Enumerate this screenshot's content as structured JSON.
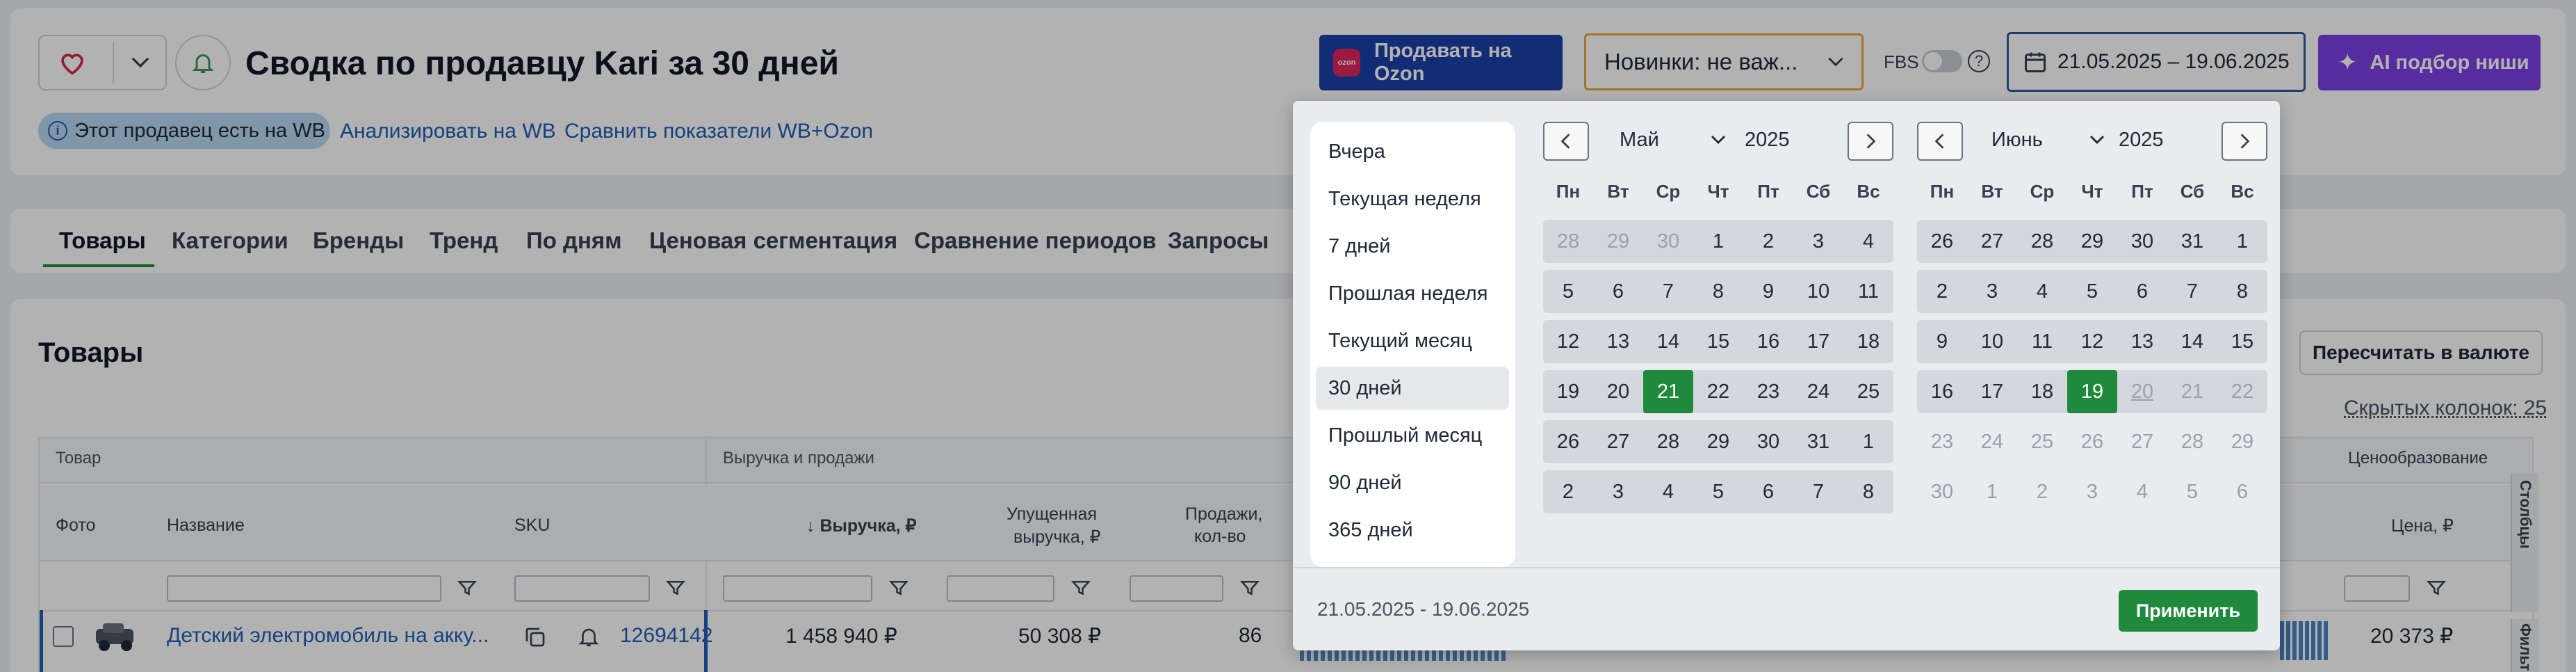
{
  "header": {
    "title": "Сводка по продавцу Kari за 30 дней",
    "ozon_button": "Продавать на Ozon",
    "ozon_badge": "ozon",
    "novelty_select": "Новинки: не важ...",
    "fbs_label": "FBS",
    "date_range": "21.05.2025 – 19.06.2025",
    "ai_button": "AI подбор ниши",
    "wb_badge": "Этот продавец есть на WB",
    "analyze_wb": "Анализировать на WB",
    "compare_wb_ozon": "Сравнить показатели WB+Ozon"
  },
  "tabs": [
    "Товары",
    "Категории",
    "Бренды",
    "Тренд",
    "По дням",
    "Ценовая сегментация",
    "Сравнение периодов",
    "Запросы"
  ],
  "section": {
    "title": "Товары",
    "recalc_button": "Пересчитать в валюте",
    "hidden_columns": "Скрытых колонок: 25"
  },
  "table": {
    "groups": {
      "product": "Товар",
      "revenue": "Выручка и продажи",
      "pricing": "Ценообразование"
    },
    "columns": {
      "photo": "Фото",
      "name": "Название",
      "sku": "SKU",
      "revenue": "↓ Выручка, ₽",
      "lost_revenue_1": "Упущенная",
      "lost_revenue_2": "выручка, ₽",
      "sales_1": "Продажи,",
      "sales_2": "кол-во",
      "price": "Цена, ₽"
    },
    "side_tabs": {
      "columns": "Столбцы",
      "filters": "Фильтры"
    },
    "row": {
      "name": "Детский электромобиль на акку...",
      "sku": "12694142",
      "revenue": "1 458 940 ₽",
      "lost_revenue": "50 308 ₽",
      "sales": "86",
      "price": "20 373 ₽"
    }
  },
  "date_picker": {
    "presets": [
      "Вчера",
      "Текущая неделя",
      "7 дней",
      "Прошлая неделя",
      "Текущий месяц",
      "30 дней",
      "Прошлый месяц",
      "90 дней",
      "365 дней"
    ],
    "selected_preset": "30 дней",
    "weekdays": [
      "Пн",
      "Вт",
      "Ср",
      "Чт",
      "Пт",
      "Сб",
      "Вс"
    ],
    "left": {
      "month": "Май",
      "year": "2025",
      "weeks": [
        [
          "28",
          "29",
          "30",
          "1",
          "2",
          "3",
          "4"
        ],
        [
          "5",
          "6",
          "7",
          "8",
          "9",
          "10",
          "11"
        ],
        [
          "12",
          "13",
          "14",
          "15",
          "16",
          "17",
          "18"
        ],
        [
          "19",
          "20",
          "21",
          "22",
          "23",
          "24",
          "25"
        ],
        [
          "26",
          "27",
          "28",
          "29",
          "30",
          "31",
          "1"
        ],
        [
          "2",
          "3",
          "4",
          "5",
          "6",
          "7",
          "8"
        ]
      ]
    },
    "right": {
      "month": "Июнь",
      "year": "2025",
      "weeks": [
        [
          "26",
          "27",
          "28",
          "29",
          "30",
          "31",
          "1"
        ],
        [
          "2",
          "3",
          "4",
          "5",
          "6",
          "7",
          "8"
        ],
        [
          "9",
          "10",
          "11",
          "12",
          "13",
          "14",
          "15"
        ],
        [
          "16",
          "17",
          "18",
          "19",
          "20",
          "21",
          "22"
        ],
        [
          "23",
          "24",
          "25",
          "26",
          "27",
          "28",
          "29"
        ],
        [
          "30",
          "1",
          "2",
          "3",
          "4",
          "5",
          "6"
        ]
      ]
    },
    "range_text": "21.05.2025 - 19.06.2025",
    "apply_button": "Применить"
  },
  "colors": {
    "accent_green": "#1f8a3c",
    "ozon_blue": "#1b3fa8",
    "ai_purple": "#7b3fe4",
    "link": "#1f5fb5"
  }
}
